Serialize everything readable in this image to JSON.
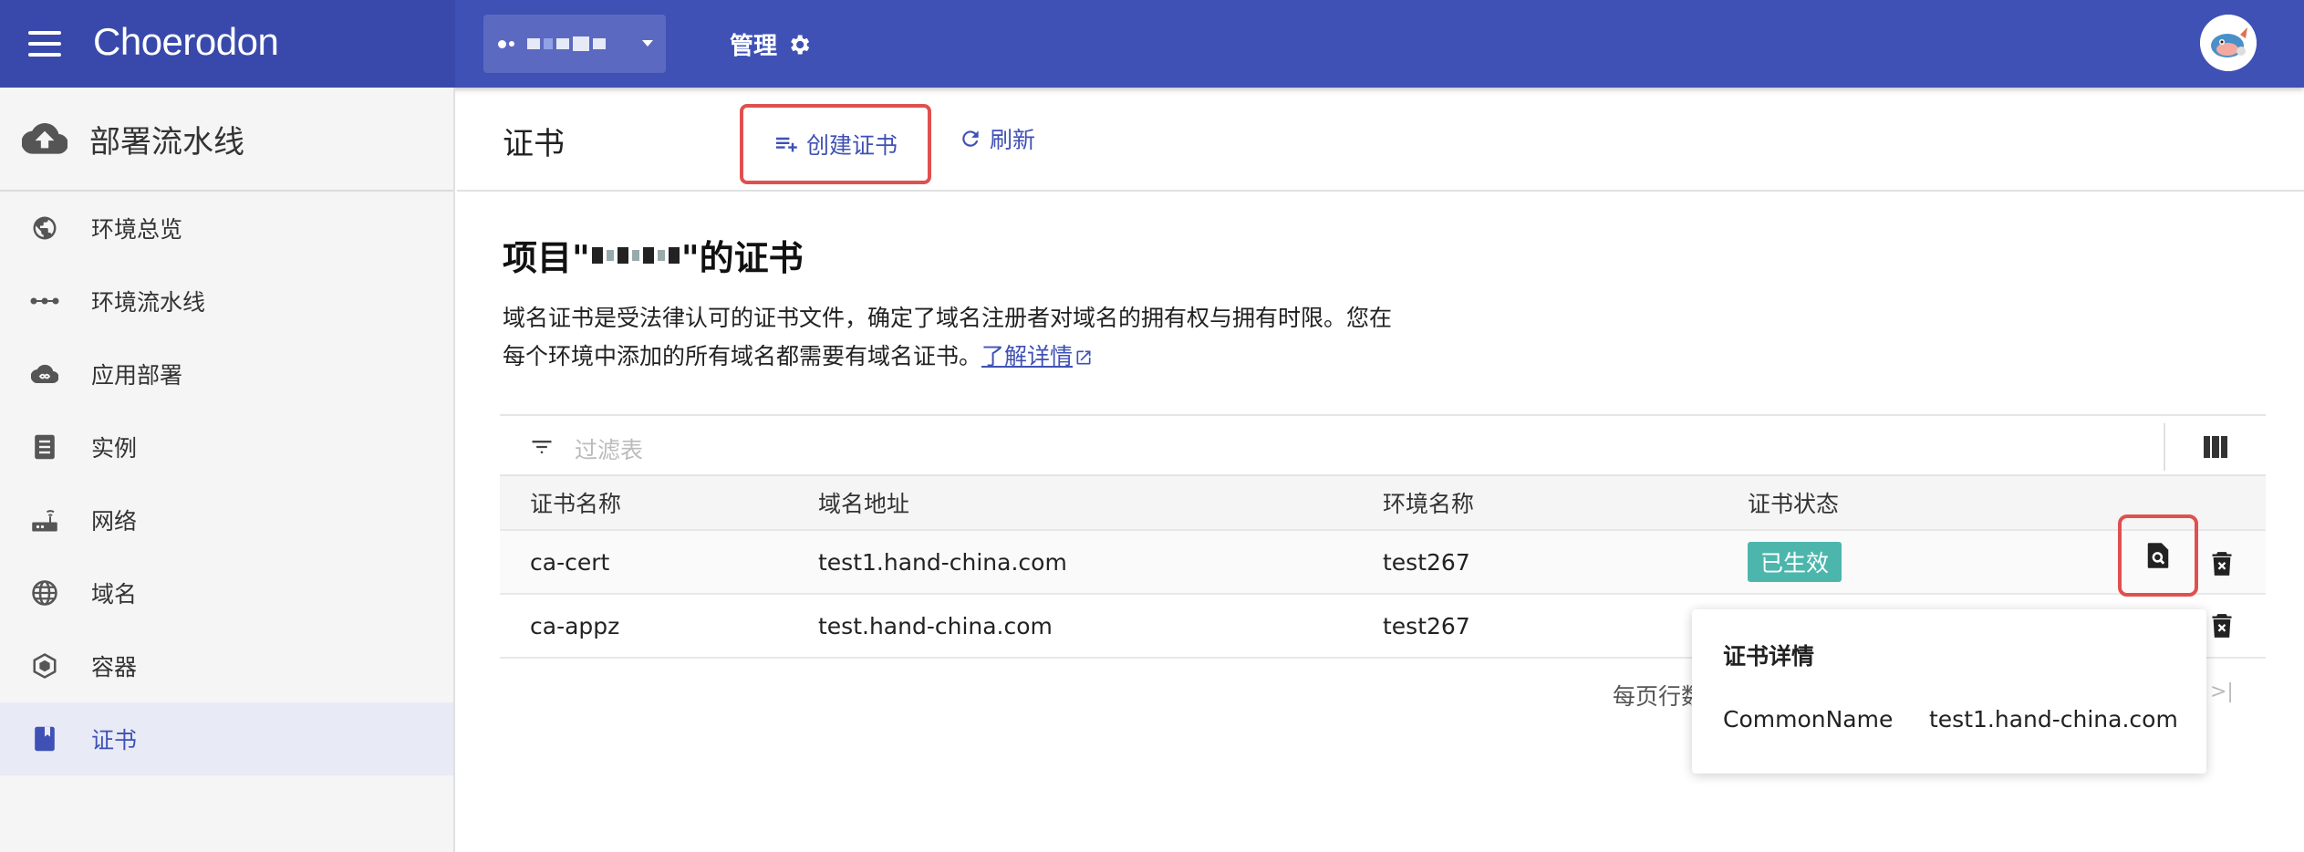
{
  "header": {
    "brand": "Choerodon",
    "manage_label": "管理"
  },
  "sidebar": {
    "section_title": "部署流水线",
    "items": [
      {
        "label": "环境总览",
        "icon": "globe-icon"
      },
      {
        "label": "环境流水线",
        "icon": "pipeline-dots-icon"
      },
      {
        "label": "应用部署",
        "icon": "cloud-infinity-icon"
      },
      {
        "label": "实例",
        "icon": "instance-icon"
      },
      {
        "label": "网络",
        "icon": "router-icon"
      },
      {
        "label": "域名",
        "icon": "domain-globe-icon"
      },
      {
        "label": "容器",
        "icon": "container-icon"
      },
      {
        "label": "证书",
        "icon": "book-icon",
        "active": true
      }
    ]
  },
  "page": {
    "title": "证书",
    "create_label": "创建证书",
    "refresh_label": "刷新",
    "content_title_prefix": "项目\"",
    "content_title_suffix": "\"的证书",
    "description_line1": "域名证书是受法律认可的证书文件，确定了域名注册者对域名的拥有权与拥有时限。您在",
    "description_line2": "每个环境中添加的所有域名都需要有域名证书。",
    "learn_more": "了解详情"
  },
  "table": {
    "filter_placeholder": "过滤表",
    "headers": [
      "证书名称",
      "域名地址",
      "环境名称",
      "证书状态"
    ],
    "rows": [
      {
        "name": "ca-cert",
        "domain": "test1.hand-china.com",
        "env": "test267",
        "status": "已生效"
      },
      {
        "name": "ca-appz",
        "domain": "test.hand-china.com",
        "env": "test267",
        "status": ""
      }
    ],
    "rows_per_page_label": "每页行数"
  },
  "popover": {
    "title": "证书详情",
    "key": "CommonName",
    "value": "test1.hand-china.com"
  },
  "colors": {
    "primary": "#3f51b5",
    "brand_bg": "#3949ab",
    "status_active": "#4db6ac",
    "highlight_border": "#e05050"
  }
}
